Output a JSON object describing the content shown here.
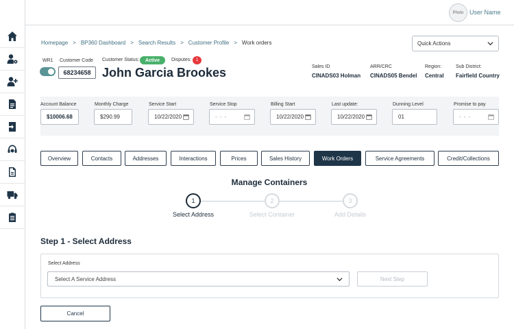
{
  "header": {
    "avatar_text": "Photo",
    "user_name": "User Name"
  },
  "sidebar": {
    "items": [
      {
        "icon": "home-icon"
      },
      {
        "icon": "user-settings-icon"
      },
      {
        "icon": "add-user-icon"
      },
      {
        "icon": "document-icon"
      },
      {
        "icon": "sign-in-icon"
      },
      {
        "icon": "headset-icon"
      },
      {
        "icon": "file-icon"
      },
      {
        "icon": "truck-icon"
      },
      {
        "icon": "clipboard-icon"
      }
    ]
  },
  "breadcrumb": {
    "items": [
      "Homepage",
      "BP360 Dashboard",
      "Search Results",
      "Customer Profile",
      "Work orders"
    ],
    "separator": ">"
  },
  "quick_actions": {
    "label": "Quick Actions"
  },
  "customer": {
    "wr_label": "WR1",
    "code_label": "Customer Code",
    "code": "68234658",
    "status_label": "Customer Status:",
    "status": "Active",
    "status_color": "#49b06b",
    "disputes_label": "Disputes:",
    "disputes_count": "1",
    "name": "John Garcia Brookes"
  },
  "meta": {
    "sales_id_label": "Sales ID",
    "sales_id": "CINADS03 Holman",
    "arr_label": "ARR/CRC",
    "arr": "CINADS05 Bendel",
    "region_label": "Region:",
    "region": "Central",
    "sub_district_label": "Sub District:",
    "sub_district": "Fairfield Country"
  },
  "account": {
    "balance_label": "Account Balance",
    "balance": "$10006.68",
    "monthly_label": "Monthly Charge",
    "monthly": "$290.99",
    "service_start_label": "Service Start",
    "service_start": "10/22/2020",
    "service_stop_label": "Service Stop",
    "service_stop": "- - -",
    "billing_start_label": "Billing Start",
    "billing_start": "10/22/2020",
    "last_update_label": "Last update:",
    "last_update": "10/22/2020",
    "dunning_label": "Dunning Level",
    "dunning": "01",
    "promise_label": "Promise to pay",
    "promise": "- - -"
  },
  "tabs": [
    {
      "label": "Overview",
      "active": false
    },
    {
      "label": "Contacts",
      "active": false
    },
    {
      "label": "Addresses",
      "active": false
    },
    {
      "label": "Interactions",
      "active": false
    },
    {
      "label": "Prices",
      "active": false
    },
    {
      "label": "Sales History",
      "active": false
    },
    {
      "label": "Work Orders",
      "active": true
    },
    {
      "label": "Service Agreements",
      "active": false
    },
    {
      "label": "Credit/Collections",
      "active": false
    }
  ],
  "manage": {
    "title": "Manage Containers",
    "steps": [
      {
        "number": "1",
        "label": "Select Address",
        "active": true
      },
      {
        "number": "2",
        "label": "Select Container",
        "active": false
      },
      {
        "number": "3",
        "label": "Add Details",
        "active": false
      }
    ]
  },
  "step1": {
    "heading": "Step 1 - Select Address",
    "select_label": "Select Address",
    "select_value": "Select A Service Address",
    "next_label": "Next Step"
  },
  "cancel_label": "Cancel"
}
